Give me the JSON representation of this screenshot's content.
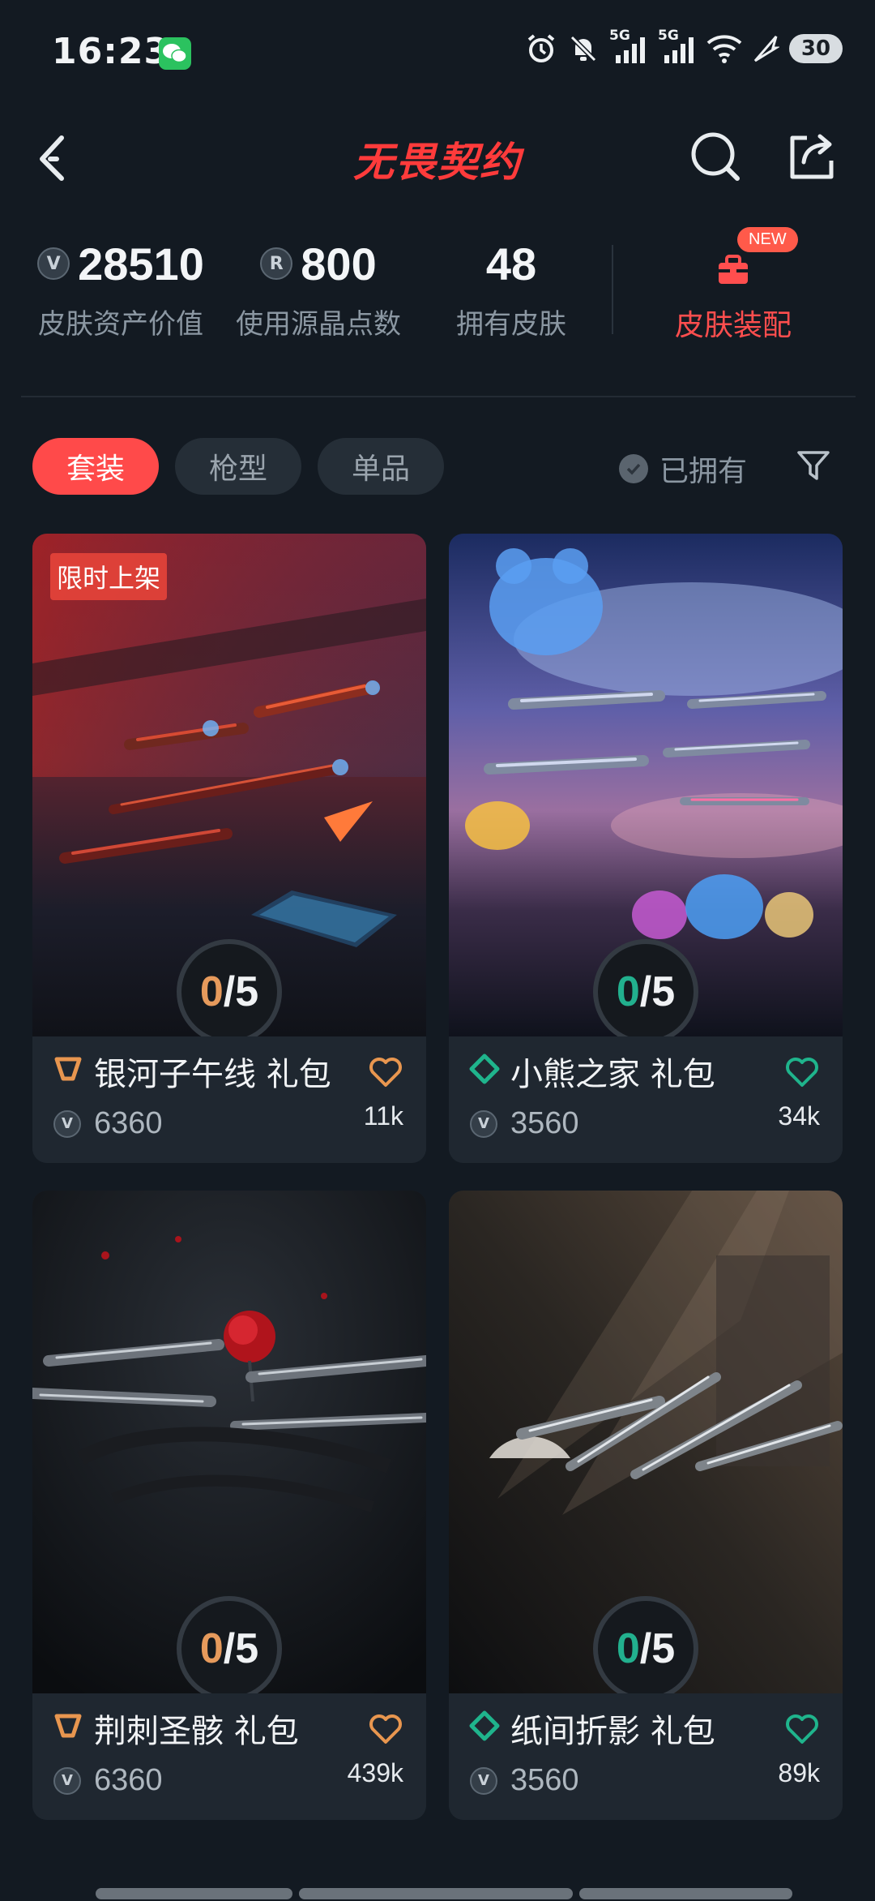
{
  "status_bar": {
    "time": "16:23",
    "battery": "30",
    "network1": "5G",
    "network2": "5G"
  },
  "header": {
    "title": "无畏契约"
  },
  "stats": {
    "asset_value": "28510",
    "asset_label": "皮肤资产价值",
    "radianite_points": "800",
    "radianite_label": "使用源晶点数",
    "skins_owned": "48",
    "skins_owned_label": "拥有皮肤",
    "skin_config_label": "皮肤装配",
    "new_badge": "NEW",
    "coin_v": "V",
    "coin_r": "R"
  },
  "tabs": [
    {
      "label": "套装",
      "active": true
    },
    {
      "label": "枪型",
      "active": false
    },
    {
      "label": "单品",
      "active": false
    }
  ],
  "owned_filter_label": "已拥有",
  "cards": [
    {
      "name": "银河子午线 礼包",
      "badge": "限时上架",
      "owned": "0",
      "total": "/5",
      "price": "6360",
      "likes": "11k",
      "tier_color": "#e8964f"
    },
    {
      "name": "小熊之家 礼包",
      "badge": "",
      "owned": "0",
      "total": "/5",
      "price": "3560",
      "likes": "34k",
      "tier_color": "#1fb48c"
    },
    {
      "name": "荆刺圣骸 礼包",
      "badge": "",
      "owned": "0",
      "total": "/5",
      "price": "6360",
      "likes": "439k",
      "tier_color": "#e8964f"
    },
    {
      "name": "纸间折影 礼包",
      "badge": "",
      "owned": "0",
      "total": "/5",
      "price": "3560",
      "likes": "89k",
      "tier_color": "#1fb48c"
    }
  ]
}
